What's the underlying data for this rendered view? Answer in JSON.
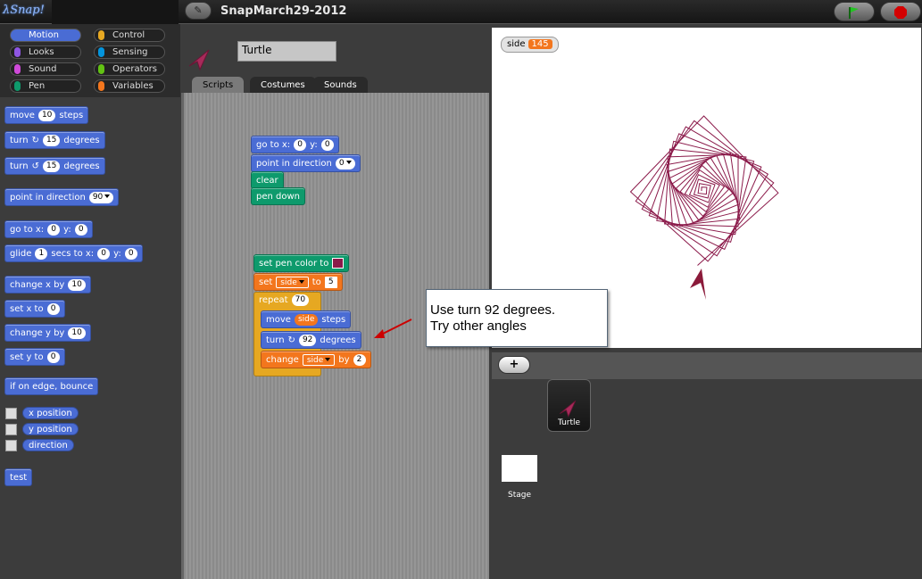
{
  "app": {
    "logo": "λSnap!",
    "project_title": "SnapMarch29-2012",
    "edit_icon": "pencil-icon",
    "flag_icon": "green-flag-icon",
    "stop_icon": "stop-icon"
  },
  "categories": [
    {
      "label": "Motion",
      "color": "#4a6cd4",
      "selected": true
    },
    {
      "label": "Control",
      "color": "#e6a822"
    },
    {
      "label": "Looks",
      "color": "#8f56e3"
    },
    {
      "label": "Sensing",
      "color": "#0494dc"
    },
    {
      "label": "Sound",
      "color": "#cf4ad9"
    },
    {
      "label": "Operators",
      "color": "#62c213"
    },
    {
      "label": "Pen",
      "color": "#0e9a6c"
    },
    {
      "label": "Variables",
      "color": "#f3761d"
    }
  ],
  "palette": {
    "move": {
      "pre": "move",
      "val": "10",
      "post": "steps"
    },
    "turn_cw": {
      "pre": "turn",
      "val": "15",
      "post": "degrees"
    },
    "turn_ccw": {
      "pre": "turn",
      "val": "15",
      "post": "degrees"
    },
    "point": {
      "pre": "point in direction",
      "val": "90"
    },
    "goto": {
      "pre": "go to x:",
      "x": "0",
      "mid": "y:",
      "y": "0"
    },
    "glide": {
      "pre": "glide",
      "secs": "1",
      "mid1": "secs to x:",
      "x": "0",
      "mid2": "y:",
      "y": "0"
    },
    "change_x": {
      "pre": "change x by",
      "val": "10"
    },
    "set_x": {
      "pre": "set x to",
      "val": "0"
    },
    "change_y": {
      "pre": "change y by",
      "val": "10"
    },
    "set_y": {
      "pre": "set y to",
      "val": "0"
    },
    "bounce": {
      "label": "if on edge, bounce"
    },
    "reporters": [
      "x position",
      "y position",
      "direction"
    ],
    "custom": "test"
  },
  "sprite": {
    "name": "Turtle",
    "tabs": [
      "Scripts",
      "Costumes",
      "Sounds"
    ]
  },
  "script1": {
    "goto": {
      "pre": "go to x:",
      "x": "0",
      "mid": "y:",
      "y": "0"
    },
    "point": {
      "pre": "point in direction",
      "val": "0"
    },
    "clear": "clear",
    "pen_down": "pen down"
  },
  "script2": {
    "set_pen_color": "set pen color to",
    "pen_color": "#8b1a4a",
    "set": {
      "pre": "set",
      "var": "side",
      "mid": "to",
      "val": "5"
    },
    "repeat": {
      "pre": "repeat",
      "val": "70"
    },
    "move": {
      "pre": "move",
      "var": "side",
      "post": "steps"
    },
    "turn": {
      "pre": "turn",
      "val": "92",
      "post": "degrees"
    },
    "change": {
      "pre": "change",
      "var": "side",
      "mid": "by",
      "val": "2"
    }
  },
  "stage": {
    "watcher_name": "side",
    "watcher_value": "145"
  },
  "callout": {
    "line1": "Use turn 92 degrees.",
    "line2": "Try other angles"
  },
  "corral": {
    "add_label": "+",
    "sprite_name": "Turtle",
    "stage_label": "Stage"
  }
}
